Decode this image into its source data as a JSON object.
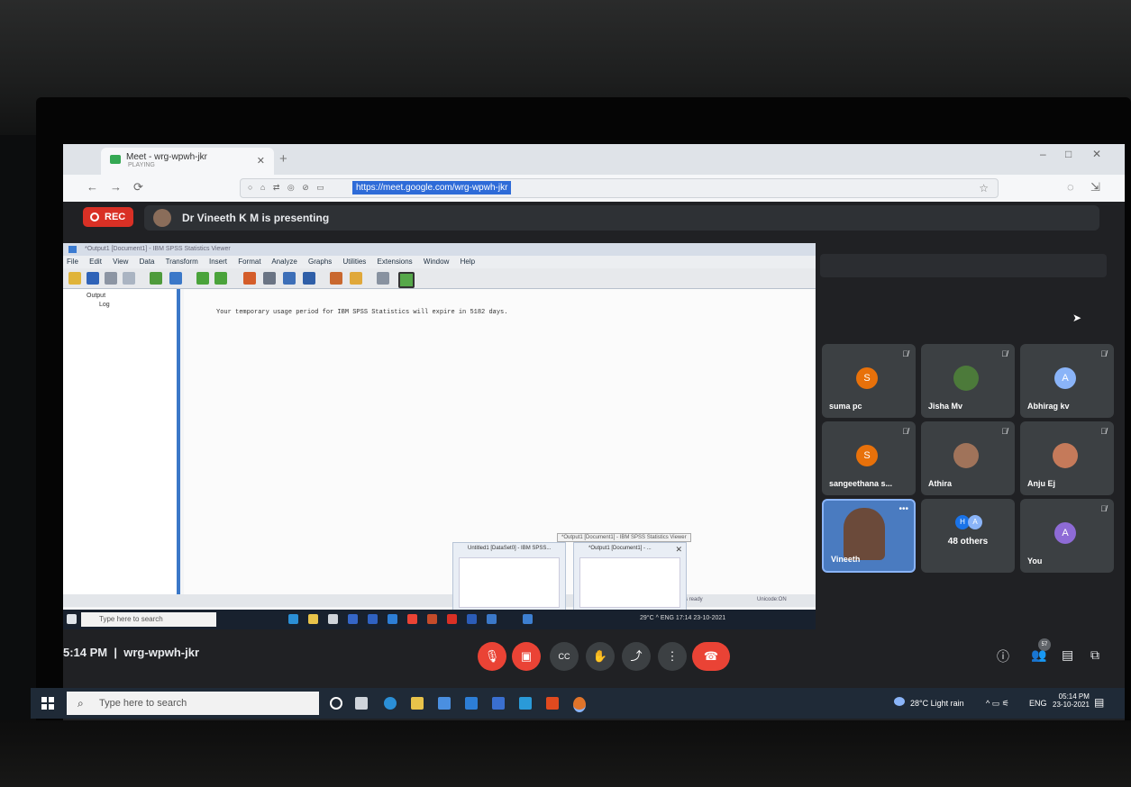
{
  "browser": {
    "tab_title": "Meet - wrg-wpwh-jkr",
    "tab_sub": "PLAYING",
    "url": "https://meet.google.com/wrg-wpwh-jkr"
  },
  "meet": {
    "rec_label": "REC",
    "presenting_text": "Dr Vineeth K M is presenting",
    "time": "5:14 PM",
    "meeting_code": "wrg-wpwh-jkr",
    "people_badge": "57"
  },
  "spss": {
    "title": "*Output1 [Document1] - IBM SPSS Statistics Viewer",
    "menu": [
      "File",
      "Edit",
      "View",
      "Data",
      "Transform",
      "Insert",
      "Format",
      "Analyze",
      "Graphs",
      "Utilities",
      "Extensions",
      "Window",
      "Help"
    ],
    "tree": [
      "Output",
      "Log"
    ],
    "message": "Your temporary usage period for IBM SPSS Statistics will expire in 5182 days.",
    "status_ready": "Processor is ready",
    "status_unicode": "Unicode:ON",
    "preview_tooltip": "*Output1 [Document1] - IBM SPSS Statistics Viewer",
    "preview1": "Untitled1 [DataSet0] - IBM SPSS...",
    "preview2": "*Output1 [Document1] - ...",
    "taskbar_search": "Type here to search",
    "tray": "29°C  ^  ENG  17:14  23-10-2021"
  },
  "participants": [
    {
      "name": "suma pc",
      "initial": "S",
      "color": "#e8710a"
    },
    {
      "name": "Jisha Mv",
      "initial": "",
      "color": "#4c7a3a"
    },
    {
      "name": "Abhirag kv",
      "initial": "A",
      "color": "#8ab4f8"
    },
    {
      "name": "sangeethana s...",
      "initial": "S",
      "color": "#e8710a"
    },
    {
      "name": "Athira",
      "initial": "",
      "color": "#a0735a"
    },
    {
      "name": "Anju Ej",
      "initial": "",
      "color": "#c57a5a"
    },
    {
      "name": "Vineeth",
      "initial": "",
      "color": ""
    },
    {
      "name": "48 others",
      "initial": "",
      "color": ""
    },
    {
      "name": "You",
      "initial": "A",
      "color": "#8e6bd6"
    }
  ],
  "others_initials": [
    "H",
    "A"
  ],
  "host_taskbar": {
    "search": "Type here to search",
    "weather": "28°C  Light rain",
    "lang": "ENG",
    "time": "05:14 PM",
    "date": "23-10-2021"
  }
}
